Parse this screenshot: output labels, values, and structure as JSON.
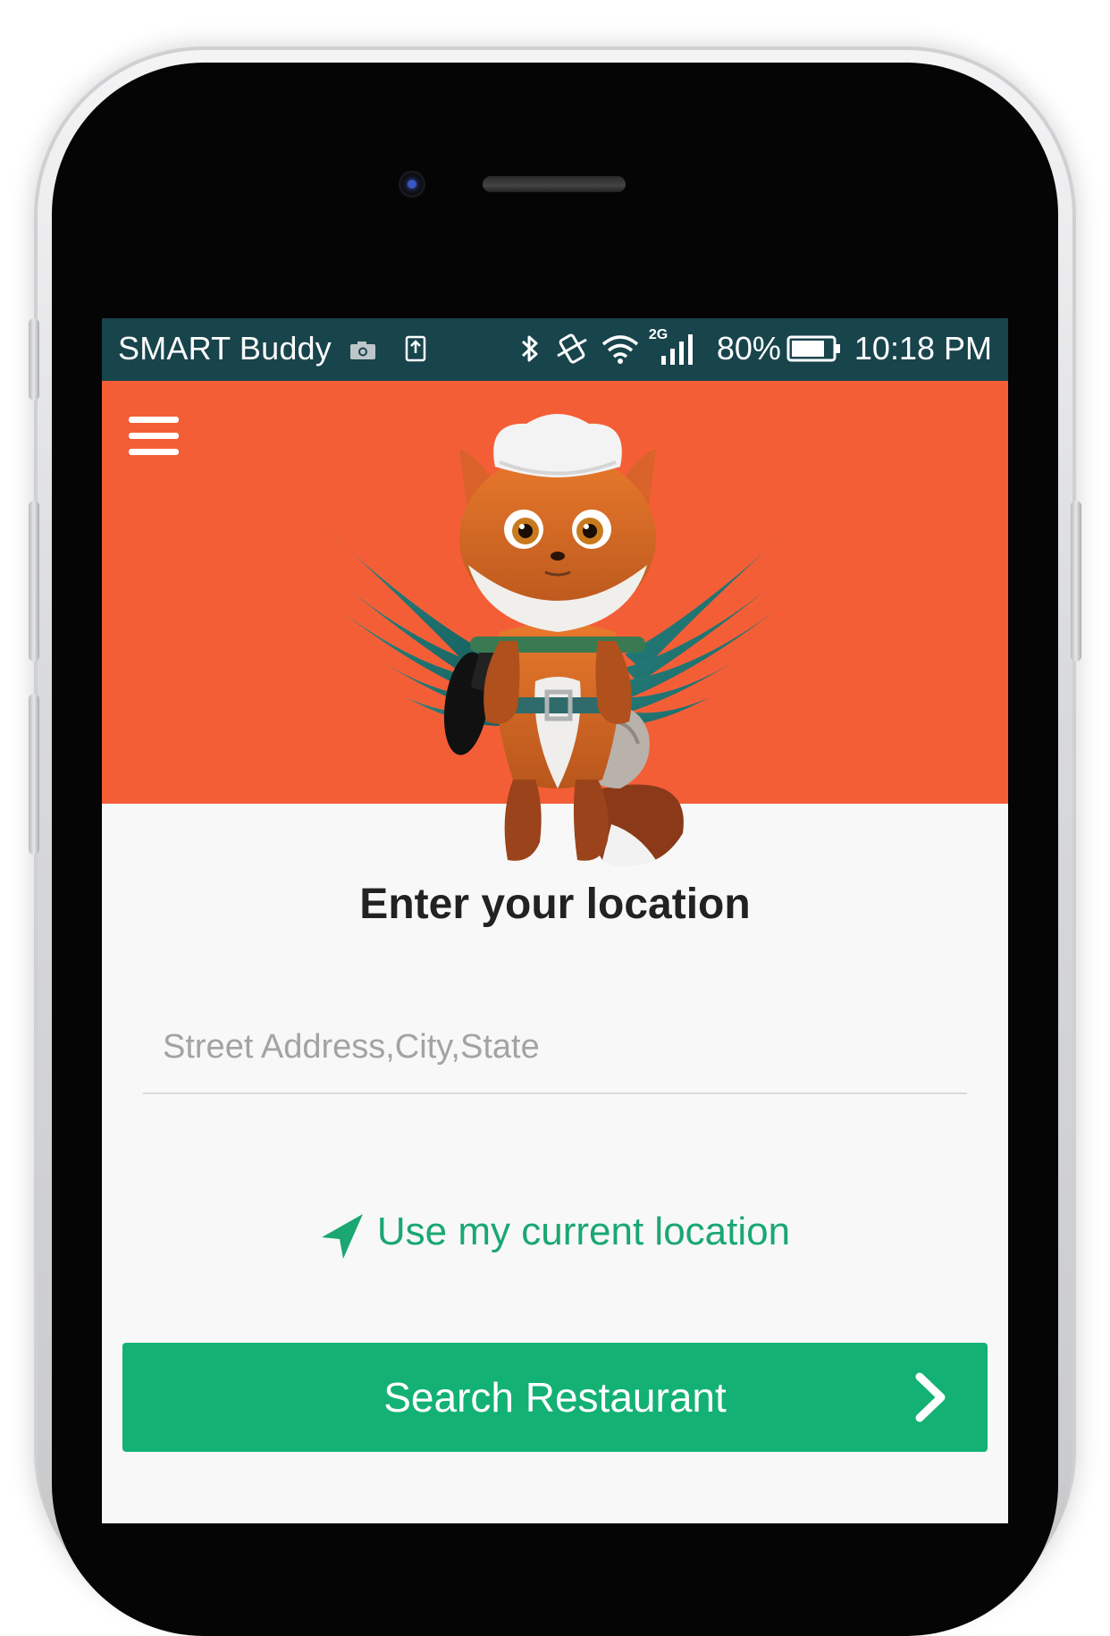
{
  "status_bar": {
    "carrier": "SMART Buddy",
    "network": "2G",
    "battery": "80%",
    "time": "10:18 PM"
  },
  "header": {
    "background": "#f45e37",
    "mascot": "chef fox with wings"
  },
  "main": {
    "title": "Enter your location",
    "address_placeholder": "Street Address,City,State",
    "current_location_label": "Use my current location",
    "search_button_label": "Search Restaurant"
  },
  "colors": {
    "status_bar": "#18444c",
    "accent_green": "#13b174",
    "link_green": "#1aa772"
  }
}
